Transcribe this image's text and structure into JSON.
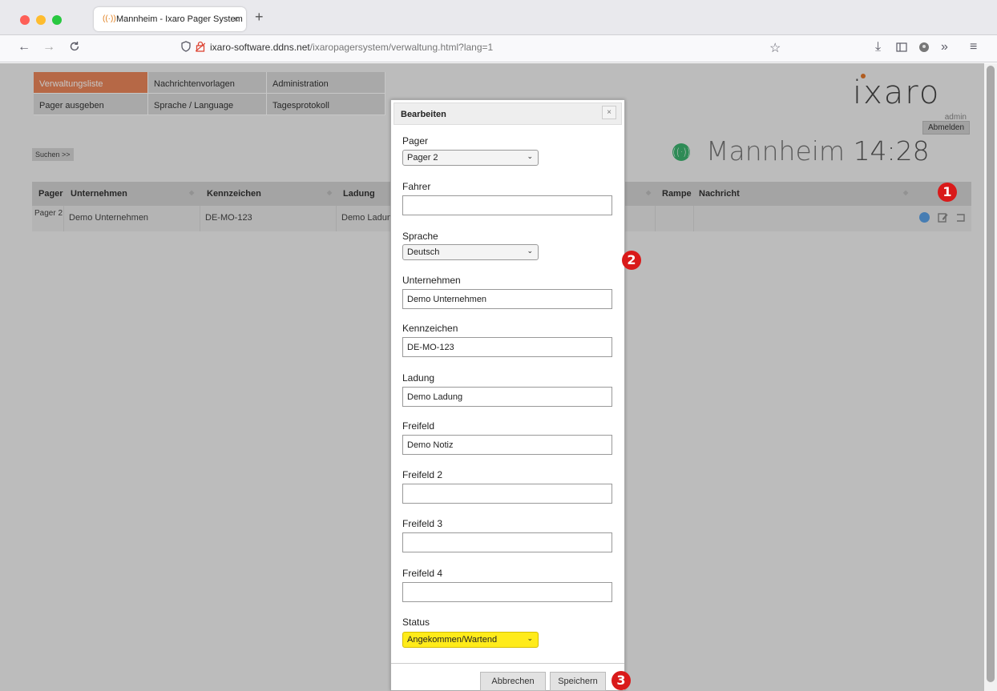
{
  "browser": {
    "tab_title": "Mannheim - Ixaro Pager System",
    "tab_close": "×",
    "new_tab": "+",
    "url_host": "ixaro-software.ddns.net",
    "url_path": "/ixaropagersystem/verwaltung.html?lang=1",
    "icons": [
      "back-icon",
      "forward-icon",
      "reload-icon",
      "shield-icon",
      "lock-icon",
      "star-icon",
      "download-icon",
      "sidebar-icon",
      "extension-icon",
      "overflow-icon",
      "menu-icon"
    ]
  },
  "menu": [
    {
      "label": "Verwaltungsliste",
      "active": true
    },
    {
      "label": "Nachrichtenvorlagen",
      "active": false
    },
    {
      "label": "Administration",
      "active": false
    },
    {
      "label": "Pager ausgeben",
      "active": false
    },
    {
      "label": "Sprache / Language",
      "active": false
    },
    {
      "label": "Tagesprotokoll",
      "active": false
    }
  ],
  "logo": "ixaro",
  "user": "admin",
  "logout": "Abmelden",
  "search": "Suchen >>",
  "location": {
    "name": "Mannheim",
    "time": "14:28"
  },
  "table": {
    "headers": [
      "Pager",
      "Unternehmen",
      "Kennzeichen",
      "Ladung",
      "Rampe",
      "Nachricht"
    ],
    "row": {
      "pager": "Pager 2",
      "unternehmen": "Demo Unternehmen",
      "kennzeichen": "DE-MO-123",
      "ladung": "Demo Ladun"
    }
  },
  "badges": [
    "1",
    "2",
    "3"
  ],
  "dialog": {
    "title": "Bearbeiten",
    "close": "×",
    "pager_label": "Pager",
    "pager_value": "Pager 2",
    "fahrer_label": "Fahrer",
    "fahrer_value": "",
    "sprache_label": "Sprache",
    "sprache_value": "Deutsch",
    "unternehmen_label": "Unternehmen",
    "unternehmen_value": "Demo Unternehmen",
    "kennzeichen_label": "Kennzeichen",
    "kennzeichen_value": "DE-MO-123",
    "ladung_label": "Ladung",
    "ladung_value": "Demo Ladung",
    "freifeld_label": "Freifeld",
    "freifeld_value": "Demo Notiz",
    "freifeld2_label": "Freifeld 2",
    "freifeld2_value": "",
    "freifeld3_label": "Freifeld 3",
    "freifeld3_value": "",
    "freifeld4_label": "Freifeld 4",
    "freifeld4_value": "",
    "status_label": "Status",
    "status_value": "Angekommen/Wartend",
    "cancel": "Abbrechen",
    "save": "Speichern"
  },
  "colors": {
    "menu_active": "#e9865a",
    "signal": "#3cb36f",
    "badge": "#d91a1a",
    "status_select": "#ffeb1a",
    "logo_dot": "#e2782b"
  }
}
